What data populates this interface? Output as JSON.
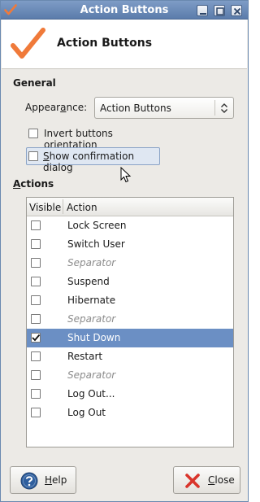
{
  "window": {
    "title": "Action Buttons",
    "header_title": "Action Buttons"
  },
  "general": {
    "title_pre": "",
    "title_u": "",
    "title": "General",
    "appearance_label_pre": "Appear",
    "appearance_label_u": "a",
    "appearance_label_post": "nce:",
    "appearance_value": "Action Buttons",
    "invert_pre": "Invert buttons ",
    "invert_u": "o",
    "invert_post": "rientation",
    "invert_checked": false,
    "confirm_pre": "",
    "confirm_u": "S",
    "confirm_post": "how confirmation dialog",
    "confirm_checked": false
  },
  "actions": {
    "title_u": "A",
    "title_post": "ctions",
    "columns": {
      "visible": "Visible",
      "action": "Action"
    },
    "rows": [
      {
        "label": "Lock Screen",
        "checked": false,
        "separator": false,
        "selected": false
      },
      {
        "label": "Switch User",
        "checked": false,
        "separator": false,
        "selected": false
      },
      {
        "label": "Separator",
        "checked": false,
        "separator": true,
        "selected": false
      },
      {
        "label": "Suspend",
        "checked": false,
        "separator": false,
        "selected": false
      },
      {
        "label": "Hibernate",
        "checked": false,
        "separator": false,
        "selected": false
      },
      {
        "label": "Separator",
        "checked": false,
        "separator": true,
        "selected": false
      },
      {
        "label": "Shut Down",
        "checked": true,
        "separator": false,
        "selected": true
      },
      {
        "label": "Restart",
        "checked": false,
        "separator": false,
        "selected": false
      },
      {
        "label": "Separator",
        "checked": false,
        "separator": true,
        "selected": false
      },
      {
        "label": "Log Out...",
        "checked": false,
        "separator": false,
        "selected": false
      },
      {
        "label": "Log Out",
        "checked": false,
        "separator": false,
        "selected": false
      }
    ]
  },
  "buttons": {
    "help_u": "H",
    "help_post": "elp",
    "close_u": "C",
    "close_post": "lose"
  },
  "colors": {
    "accent": "#6b8fc4",
    "titlebar": "#5b7cab",
    "checkmark_icon": "#f07a3a",
    "close_icon": "#d9342b",
    "help_icon": "#2f5f9e"
  },
  "icons": {
    "app": "orange-checkmark-icon",
    "help": "help-question-icon",
    "close": "red-x-icon"
  }
}
